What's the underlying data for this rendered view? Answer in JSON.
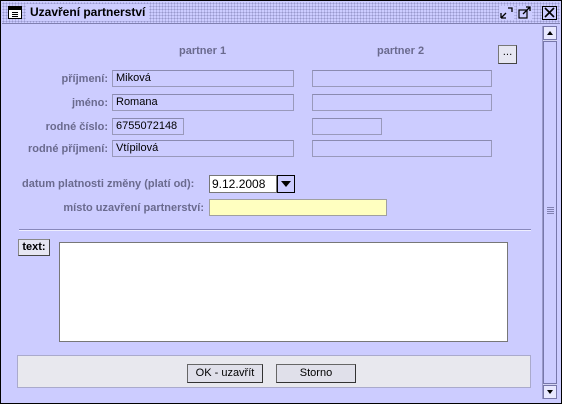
{
  "window": {
    "title": "Uzavření partnerství",
    "icon": "window-icon",
    "controls": [
      "minimize-icon",
      "maximize-icon",
      "close-icon"
    ]
  },
  "columns": {
    "partner1": "partner 1",
    "partner2": "partner 2",
    "more_button": "..."
  },
  "rows": [
    {
      "label": "příjmení:",
      "p1": "Miková",
      "p2": ""
    },
    {
      "label": "jméno:",
      "p1": "Romana",
      "p2": ""
    },
    {
      "label": "rodné číslo:",
      "p1": "6755072148",
      "p2": ""
    },
    {
      "label": "rodné příjmení:",
      "p1": "Vtípilová",
      "p2": ""
    }
  ],
  "validity": {
    "label": "datum platnosti změny (platí od):",
    "date": "9.12.2008"
  },
  "place": {
    "label": "místo uzavření partnerství:",
    "value": ""
  },
  "text_section": {
    "button_label": "text:",
    "value": ""
  },
  "footer": {
    "ok_label": "OK - uzavřít",
    "cancel_label": "Storno"
  },
  "colors": {
    "background": "#ccccff",
    "label": "#6a6a8e",
    "highlight_field": "#ffffc0"
  }
}
